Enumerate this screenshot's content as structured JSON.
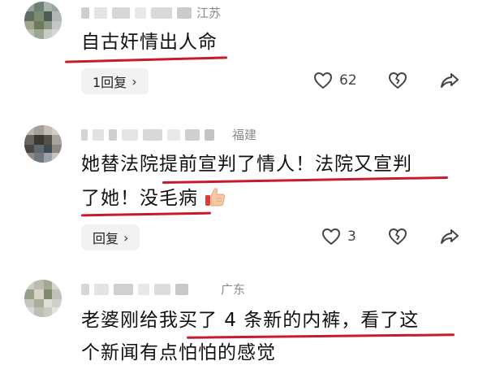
{
  "comments": [
    {
      "location": "江苏",
      "text": "自古奸情出人命",
      "reply_label": "1回复",
      "like_count": "62"
    },
    {
      "location": "福建",
      "text_line1": "她替法院提前宣判了情人！法院又宣判",
      "text_line2": "了她！没毛病",
      "reply_label": "回复",
      "like_count": "3"
    },
    {
      "location": "广东",
      "text_line1": "老婆刚给我买了 4 条新的内裤，看了这",
      "text_line2": "个新闻有点怕怕的感觉"
    }
  ],
  "icons": {
    "like": "heart-icon",
    "dislike": "broken-heart-icon",
    "share": "share-arrow-icon",
    "chevron": "chevron-right-icon",
    "thumb": "thumbs-up-emoji-icon"
  },
  "colors": {
    "underline": "#c8192d",
    "pill_bg": "#f2f2f2",
    "meta_text": "#8a8a8a"
  }
}
